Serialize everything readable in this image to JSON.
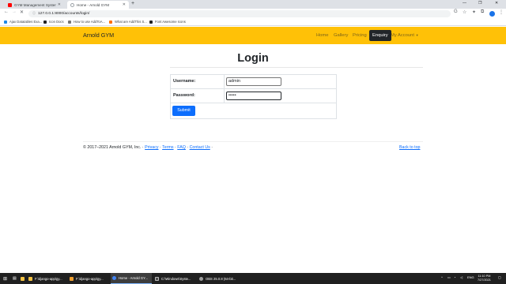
{
  "browser": {
    "tabs": [
      {
        "title": "GYM Management System in Dj..."
      },
      {
        "title": "Home - Arnold GYM"
      }
    ],
    "url": "127.0.0.1:8000/accounts/login/",
    "bookmarks": [
      {
        "label": "Ajax Datatables Exa...",
        "color": "#1e88e5"
      },
      {
        "label": "Icon Docs",
        "color": "#212121"
      },
      {
        "label": "How to use AddToA...",
        "color": "#757575"
      },
      {
        "label": "What are AddThis S...",
        "color": "#ff6d00"
      },
      {
        "label": "Font Awesome Icons",
        "color": "#212121"
      }
    ]
  },
  "site": {
    "brand": "Arnold GYM",
    "nav": {
      "home": "Home",
      "gallery": "Gallery",
      "pricing": "Pricing",
      "enquiry": "Enquiry",
      "account": "My Account"
    },
    "colors": {
      "navbar": "#ffc107",
      "primary": "#0d6efd"
    }
  },
  "login": {
    "title": "Login",
    "username_label": "Username:",
    "username_value": "admin",
    "password_label": "Password:",
    "password_value": "•••••",
    "submit_label": "Submit"
  },
  "footer": {
    "copyright": "© 2017–2021 Arnold GYM, Inc. ·",
    "privacy": "Privacy",
    "terms": "Terms",
    "faq": "FAQ",
    "contact": "Contact Us",
    "back_to_top": "Back to top"
  },
  "taskbar": {
    "items": [
      {
        "label": "F:\\django-app\\gy...",
        "icon": "#f6c343"
      },
      {
        "label": "F:\\django-app\\gy...",
        "icon": "#f0a030"
      },
      {
        "label": "Home - Arnold GY...",
        "icon": "#4285f4"
      },
      {
        "label": "C:\\Windows\\Syste...",
        "icon": "#4d4d4d"
      },
      {
        "label": "OBS 25.0.8 (64-bit...",
        "icon": "#9e9e9e"
      }
    ],
    "lang": "ENG",
    "time": "11:10 PM",
    "date": "7/27/2021"
  }
}
